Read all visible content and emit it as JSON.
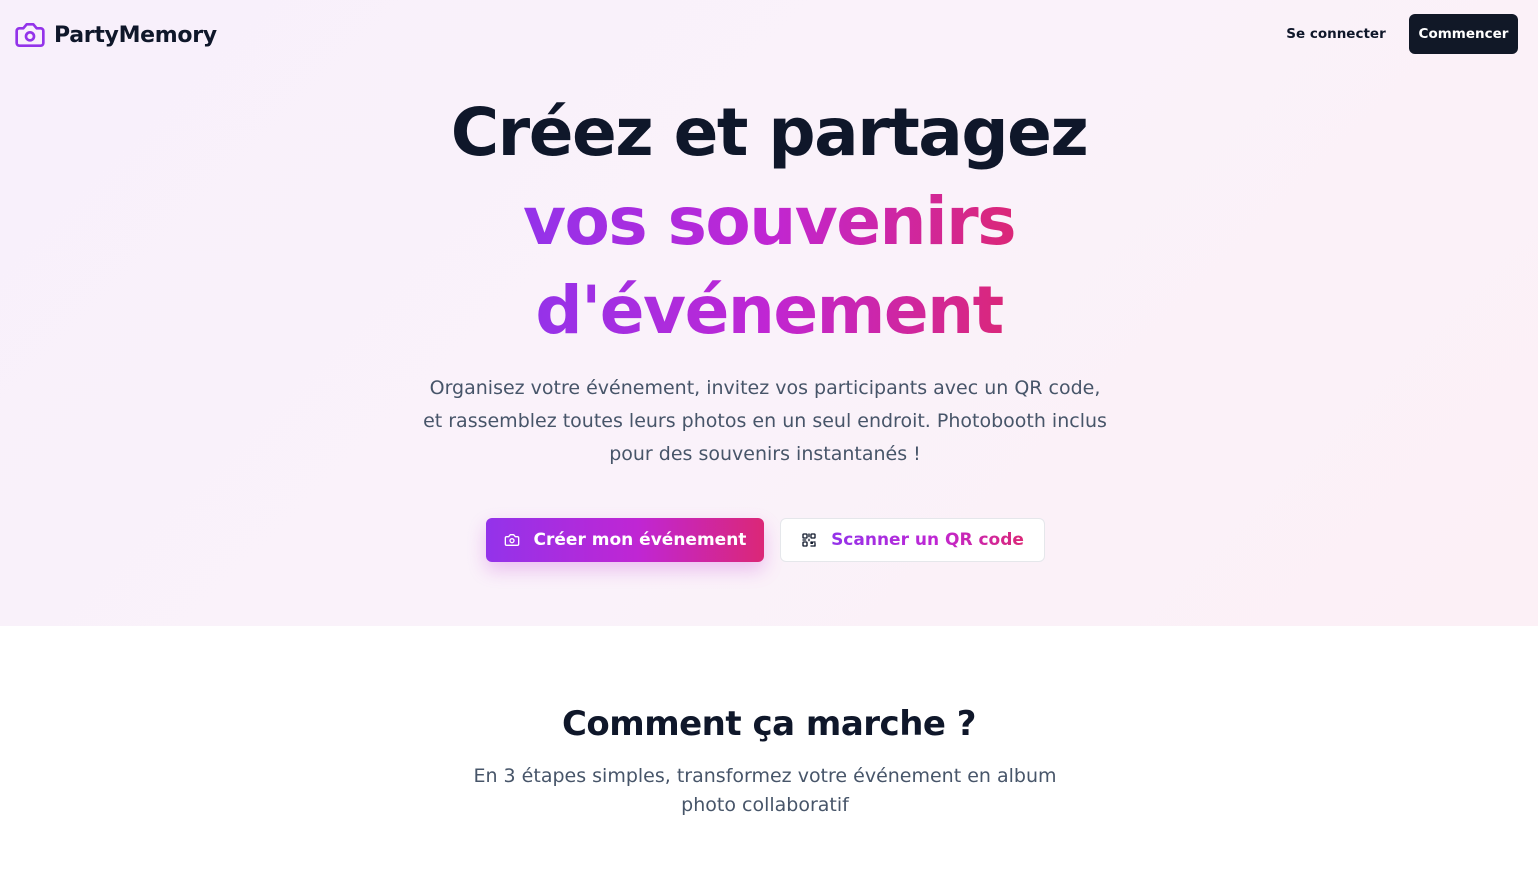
{
  "header": {
    "brand": "PartyMemory",
    "login_label": "Se connecter",
    "start_label": "Commencer"
  },
  "hero": {
    "title_line1": "Créez et partagez",
    "title_line2": "vos souvenirs",
    "title_line3": "d'événement",
    "subtitle": "Organisez votre événement, invitez vos participants avec un QR code, et rassemblez toutes leurs photos en un seul endroit. Photobooth inclus pour des souvenirs instantanés !",
    "primary_button": {
      "label": "Créer mon événement",
      "icon": "camera-icon"
    },
    "secondary_button": {
      "label": "Scanner un QR code",
      "icon": "qr-code-icon"
    }
  },
  "how_it_works": {
    "title": "Comment ça marche ?",
    "subtitle": "En 3 étapes simples, transformez votre événement en album photo collaboratif"
  },
  "colors": {
    "brand_purple": "#9333ea",
    "brand_fuchsia": "#c026d3",
    "brand_pink": "#db2777",
    "dark": "#0f172a",
    "muted": "#475569"
  }
}
